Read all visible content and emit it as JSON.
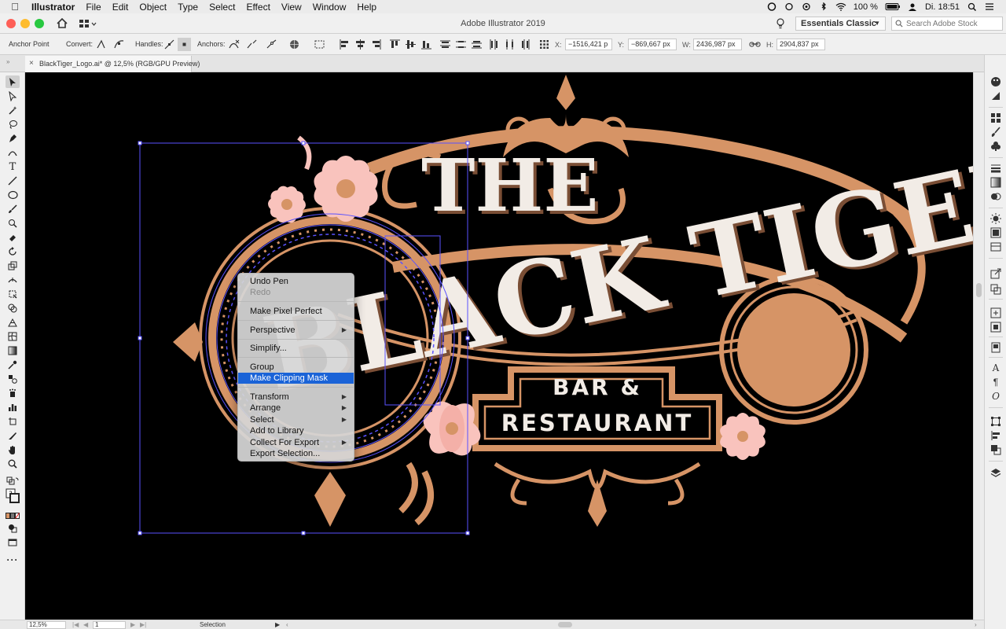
{
  "menubar": {
    "app_name": "Illustrator",
    "items": [
      "File",
      "Edit",
      "Object",
      "Type",
      "Select",
      "Effect",
      "View",
      "Window",
      "Help"
    ],
    "battery": "100 %",
    "clock": "Di. 18:51"
  },
  "appbar": {
    "title": "Adobe Illustrator 2019",
    "workspace": "Essentials Classic",
    "search_placeholder": "Search Adobe Stock"
  },
  "controlbar": {
    "mode_label": "Anchor Point",
    "convert_label": "Convert:",
    "handles_label": "Handles:",
    "anchors_label": "Anchors:",
    "x_label": "X:",
    "x_value": "−1516,421 p",
    "y_label": "Y:",
    "y_value": "−869,667 px",
    "w_label": "W:",
    "w_value": "2436,987 px",
    "h_label": "H:",
    "h_value": "2904,837 px"
  },
  "document": {
    "tab_label": "BlackTiger_Logo.ai* @ 12,5% (RGB/GPU Preview)",
    "close_glyph": "×"
  },
  "artwork": {
    "line1": "THE",
    "line2": "BLACK TIGER",
    "line3": "BAR &",
    "line4": "RESTAURANT",
    "colors": {
      "copper": "#d69466",
      "cream": "#f2ece6",
      "pink": "#f9c3bd",
      "background": "#000000",
      "selection": "#5a52ff"
    }
  },
  "context_menu": {
    "items": [
      {
        "label": "Undo Pen",
        "state": "normal",
        "submenu": false
      },
      {
        "label": "Redo",
        "state": "disabled",
        "submenu": false
      },
      {
        "label": "Make Pixel Perfect",
        "state": "normal",
        "submenu": false
      },
      {
        "label": "Perspective",
        "state": "normal",
        "submenu": true
      },
      {
        "label": "Simplify...",
        "state": "normal",
        "submenu": false
      },
      {
        "label": "Group",
        "state": "normal",
        "submenu": false
      },
      {
        "label": "Make Clipping Mask",
        "state": "highlighted",
        "submenu": false
      },
      {
        "label": "Transform",
        "state": "normal",
        "submenu": true
      },
      {
        "label": "Arrange",
        "state": "normal",
        "submenu": true
      },
      {
        "label": "Select",
        "state": "normal",
        "submenu": true
      },
      {
        "label": "Add to Library",
        "state": "normal",
        "submenu": false
      },
      {
        "label": "Collect For Export",
        "state": "normal",
        "submenu": true
      },
      {
        "label": "Export Selection...",
        "state": "normal",
        "submenu": false
      }
    ],
    "submenu_glyph": "▶"
  },
  "statusbar": {
    "zoom": "12,5%",
    "artboard": "1",
    "tool": "Selection"
  }
}
